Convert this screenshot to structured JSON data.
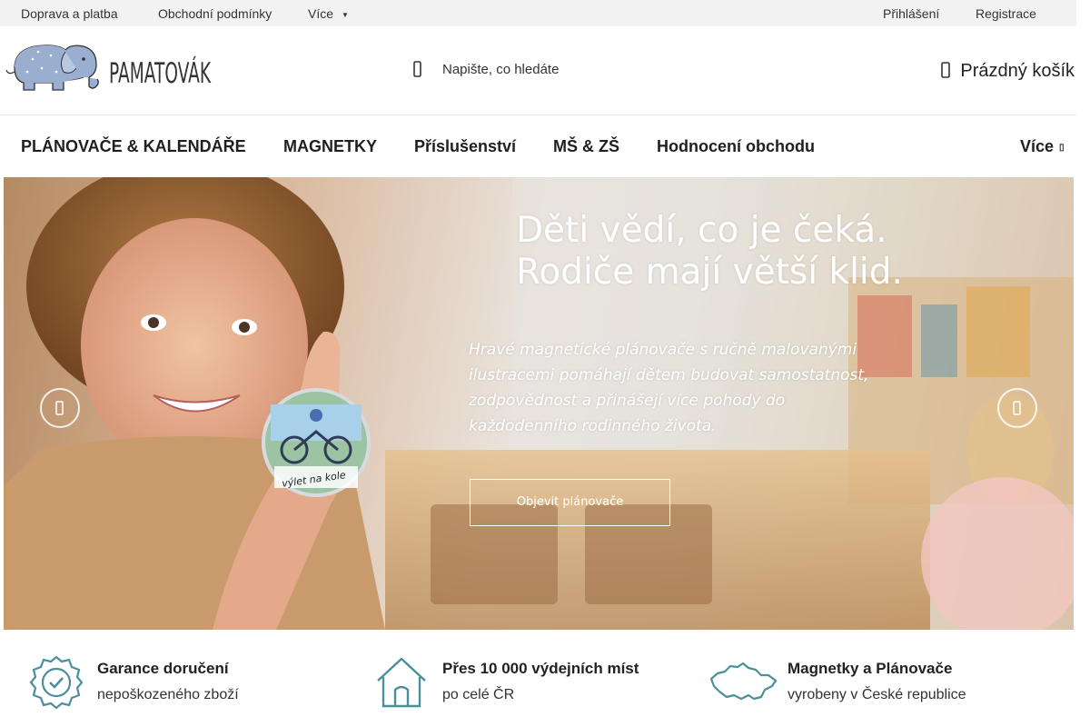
{
  "topbar": {
    "links": [
      "Doprava a platba",
      "Obchodní podmínky"
    ],
    "more_label": "Více",
    "login": "Přihlášení",
    "register": "Registrace"
  },
  "header": {
    "brand": "PAMATOVÁK",
    "search_placeholder": "Napište, co hledáte",
    "cart_label": "Prázdný košík"
  },
  "nav": {
    "items": [
      "PLÁNOVAČE & KALENDÁŘE",
      "MAGNETKY",
      "Příslušenství",
      "MŠ & ZŠ",
      "Hodnocení obchodu"
    ],
    "more_label": "Více"
  },
  "banner": {
    "headline_line1": "Děti vědí, co je čeká.",
    "headline_line2": "Rodiče mají větší klid.",
    "body": "Hravé magnetické plánovače s ručně malovanými ilustracemi pomáhají dětem budovat samostatnost, zodpovědnost a přinášejí více pohody do každodenního rodinného života.",
    "cta": "Objevit plánovače",
    "magnet_caption": "výlet na kole"
  },
  "benefits": [
    {
      "icon": "badge-check-icon",
      "title": "Garance doručení",
      "subtitle": "nepoškozeného zboží"
    },
    {
      "icon": "house-icon",
      "title": "Přes 10 000 výdejních míst",
      "subtitle": "po celé ČR"
    },
    {
      "icon": "czech-map-icon",
      "title": "Magnetky a Plánovače",
      "subtitle": "vyrobeny v České republice"
    }
  ],
  "colors": {
    "accent_teal": "#4a8f9a",
    "logo_elephant": "#9aaed0",
    "topbar_bg": "#f2f2f2"
  }
}
